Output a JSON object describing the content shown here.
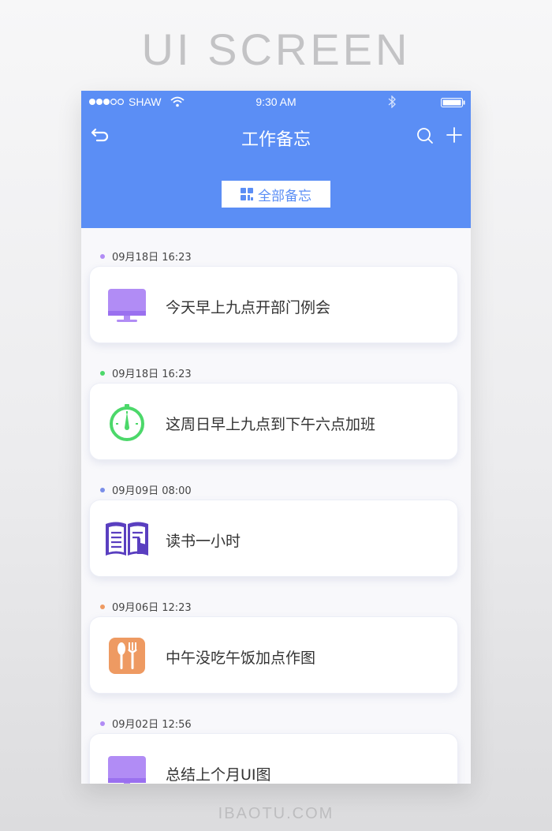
{
  "page": {
    "heading": "UI SCREEN",
    "footer": "IBAOTU.COM"
  },
  "status_bar": {
    "carrier": "SHAW",
    "time": "9:30 AM"
  },
  "nav": {
    "title": "工作备忘",
    "back_icon": "back-arrow-icon",
    "search_icon": "search-icon",
    "add_icon": "plus-icon"
  },
  "filter": {
    "label": "全部备忘",
    "icon": "grid-icon"
  },
  "colors": {
    "primary": "#5b8ef5",
    "purple": "#b18cf5",
    "green": "#4cd86a",
    "indigo": "#5a3fc0",
    "orange": "#ee9a62"
  },
  "memos": [
    {
      "date": "09月18日 16:23",
      "text": "今天早上九点开部门例会",
      "icon": "monitor-icon",
      "dot_color": "#b18cf5"
    },
    {
      "date": "09月18日 16:23",
      "text": "这周日早上九点到下午六点加班",
      "icon": "stopwatch-icon",
      "dot_color": "#4cd86a"
    },
    {
      "date": "09月09日 08:00",
      "text": "读书一小时",
      "icon": "book-icon",
      "dot_color": "#7a8ee8"
    },
    {
      "date": "09月06日 12:23",
      "text": "中午没吃午饭加点作图",
      "icon": "utensils-icon",
      "dot_color": "#ee9a62"
    },
    {
      "date": "09月02日 12:56",
      "text": "总结上个月UI图",
      "icon": "monitor-icon",
      "dot_color": "#b18cf5"
    }
  ]
}
